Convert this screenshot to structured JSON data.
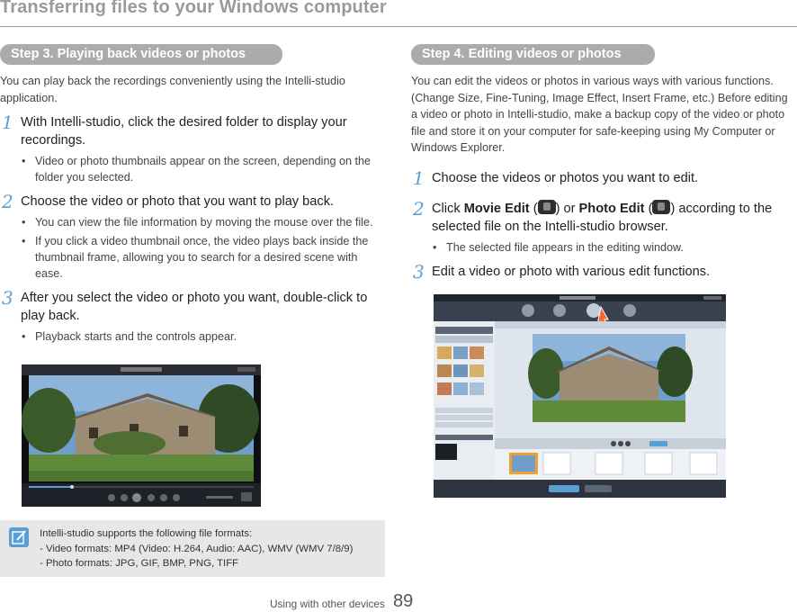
{
  "header": {
    "title": "Transferring files to your Windows computer"
  },
  "left": {
    "section_title": "Step 3. Playing back videos or photos",
    "intro": "You can play back the recordings conveniently using the Intelli-studio application.",
    "steps": [
      {
        "num": "1",
        "text": "With Intelli-studio, click the desired folder to display your recordings.",
        "bullets": [
          "Video or photo thumbnails appear on the screen, depending on the folder you selected."
        ]
      },
      {
        "num": "2",
        "text": "Choose the video or photo that you want to play back.",
        "bullets": [
          "You can view the file information by moving the mouse over the file.",
          "If you click a video thumbnail once, the video plays back inside the thumbnail frame, allowing you to search for a desired scene with ease."
        ]
      },
      {
        "num": "3",
        "text": "After you select the video or photo you want, double-click to play back.",
        "bullets": [
          "Playback starts and the controls appear."
        ]
      }
    ]
  },
  "right": {
    "section_title": "Step 4. Editing videos or photos",
    "intro": "You can edit the videos or photos in various ways with various functions. (Change Size, Fine-Tuning, Image Effect, Insert Frame, etc.) Before editing a video or photo in Intelli-studio, make a backup copy of the video or photo file and store it on your computer for safe-keeping using My Computer or Windows Explorer.",
    "steps": [
      {
        "num": "1",
        "text": "Choose the videos or photos you want to edit."
      },
      {
        "num": "2",
        "pre": "Click ",
        "b1": "Movie Edit",
        "mid1": " (",
        "mid2": ") or ",
        "b2": "Photo Edit",
        "mid3": " (",
        "post": ") according to the selected file on the Intelli-studio browser.",
        "bullets": [
          "The selected file appears in the editing window."
        ]
      },
      {
        "num": "3",
        "text": "Edit a video or photo with various edit functions."
      }
    ]
  },
  "note": {
    "icon": "note-pencil-icon",
    "lines": [
      "Intelli-studio supports the following file formats:",
      "- Video formats: MP4 (Video: H.264, Audio: AAC), WMV (WMV 7/8/9)",
      "- Photo formats: JPG, GIF, BMP, PNG, TIFF"
    ]
  },
  "footer": {
    "section": "Using with other devices",
    "page": "89"
  },
  "colors": {
    "accent": "#5a9fd4",
    "pill": "#ababab",
    "title": "#9a9a9a"
  }
}
